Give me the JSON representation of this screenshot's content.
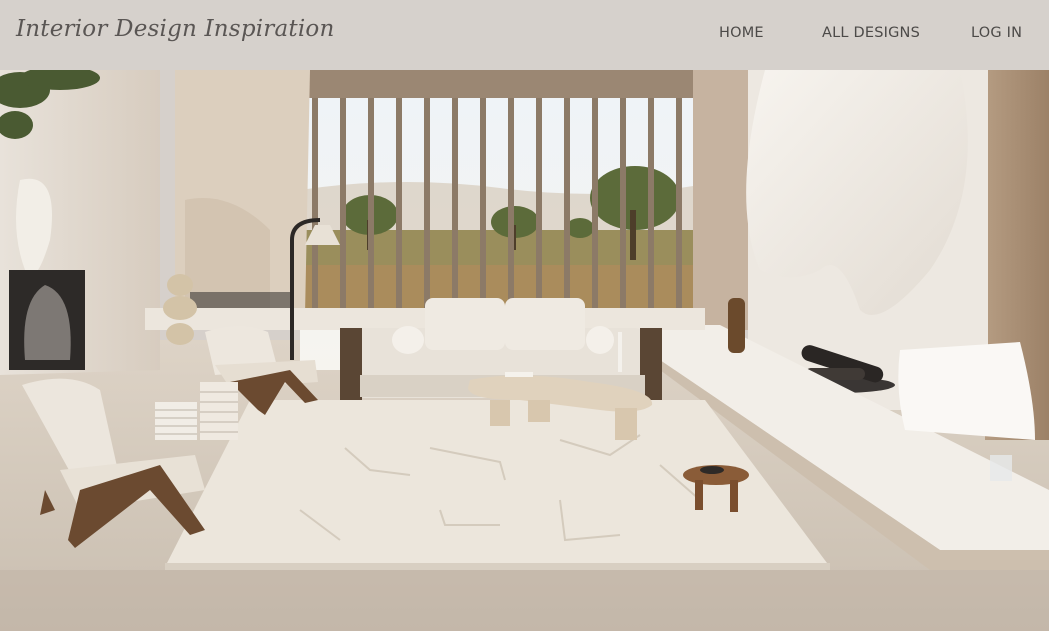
{
  "header": {
    "brand": "Interior Design Inspiration",
    "nav": [
      {
        "label": "HOME"
      },
      {
        "label": "ALL DESIGNS"
      },
      {
        "label": "LOG IN"
      }
    ]
  },
  "hero": {
    "subject": "interior-photo"
  },
  "colors": {
    "nav_background": "#d6d1cc",
    "nav_text": "#4c4a48",
    "brand_text": "#5a5654"
  }
}
